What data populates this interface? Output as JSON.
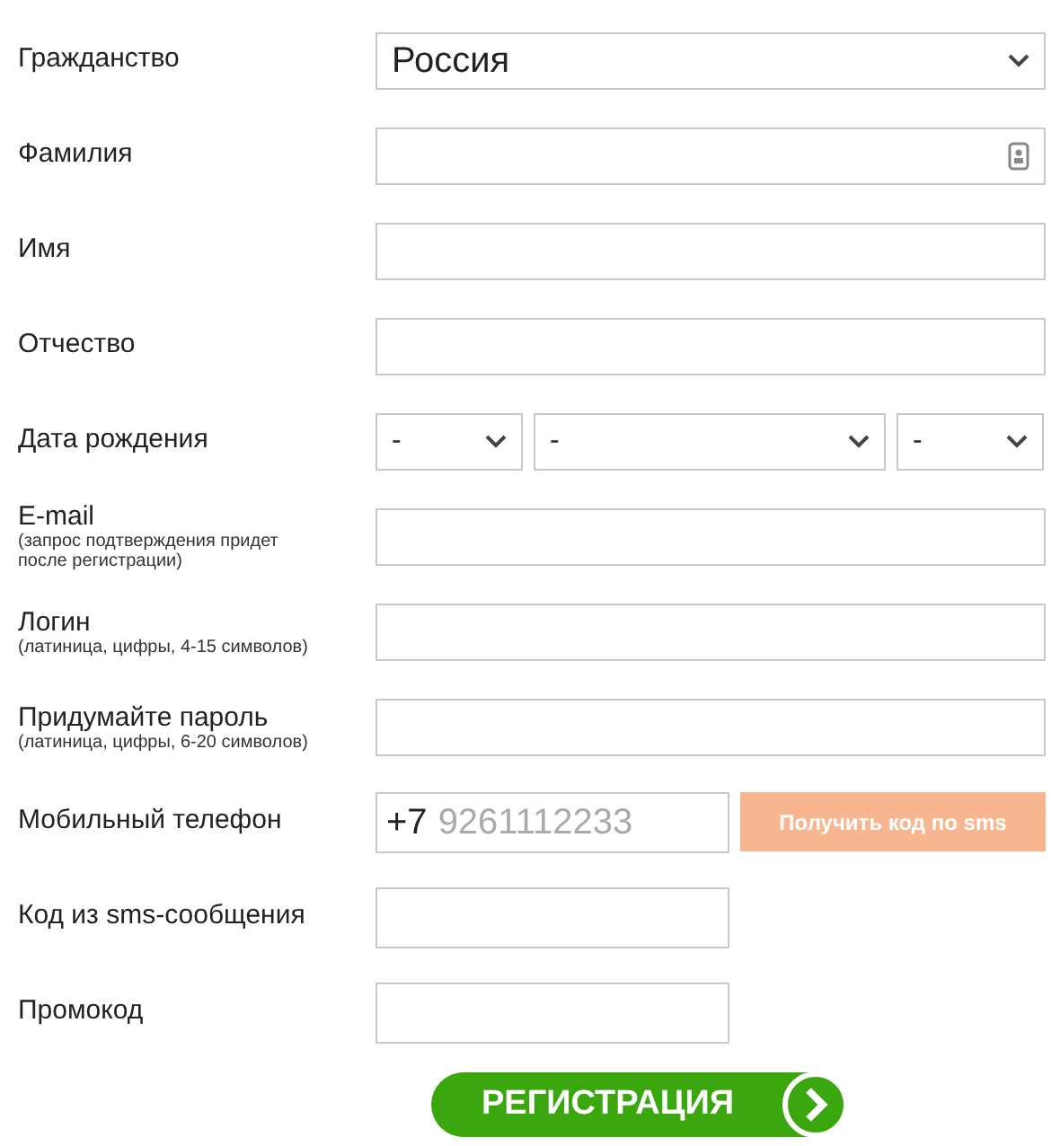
{
  "rows": [
    {
      "kind": "select",
      "label": "Гражданство",
      "value": "Россия"
    },
    {
      "kind": "text",
      "label": "Фамилия",
      "autofill_icon": true
    },
    {
      "kind": "text",
      "label": "Имя"
    },
    {
      "kind": "text",
      "label": "Отчество"
    },
    {
      "kind": "date",
      "label": "Дата рождения",
      "parts": [
        {
          "value": "-"
        },
        {
          "value": "-"
        },
        {
          "value": "-"
        }
      ]
    },
    {
      "kind": "text",
      "label": "E-mail",
      "hint": "(запрос подтверждения придет после регистрации)"
    },
    {
      "kind": "text",
      "label": "Логин",
      "hint": "(латиница, цифры, 4-15 символов)"
    },
    {
      "kind": "text",
      "label": "Придумайте пароль",
      "hint": "(латиница, цифры, 6-20 символов)"
    },
    {
      "kind": "phone",
      "label": "Мобильный телефон",
      "prefix": "+7",
      "placeholder": "9261112233",
      "button": {
        "label": "Получить код по sms",
        "disabled": true
      }
    },
    {
      "kind": "short",
      "label": "Код из sms-сообщения"
    },
    {
      "kind": "short",
      "label": "Промокод"
    }
  ],
  "submit": {
    "label": "РЕГИСТРАЦИЯ"
  }
}
